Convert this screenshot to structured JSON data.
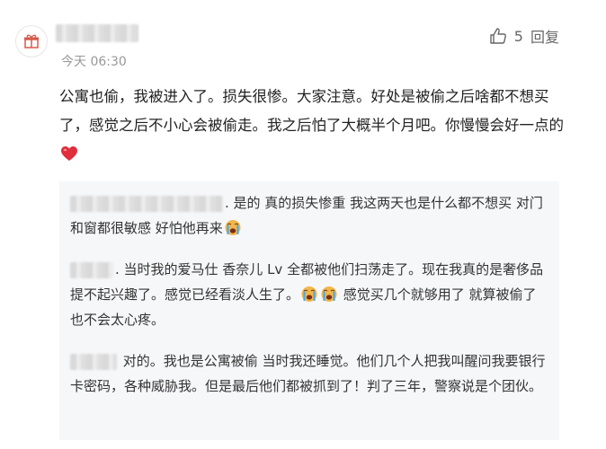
{
  "comment": {
    "time": "今天 06:30",
    "like_count": "5",
    "reply_label": "回复",
    "text": "公寓也偷，我被进入了。损失很惨。大家注意。好处是被偷之后啥都不想买了，感觉之后不小心会被偷走。我之后怕了大概半个月吧。你慢慢会好一点的"
  },
  "replies": [
    {
      "text_a": ". 是的 真的损失惨重 我这两天也是什么都不想买 对门和窗都很敏感 好怕他再来",
      "text_b": ""
    },
    {
      "text_a": ". 当时我的爱马仕 香奈儿 Lv 全都被他们扫荡走了。现在我真的是奢侈品提不起兴趣了。感觉已经看淡人生了。",
      "text_b": " 感觉买几个就够用了 就算被偷了也不会太心疼。"
    },
    {
      "text_a": " 对的。我也是公寓被偷 当时我还睡觉。他们几个人把我叫醒问我要银行卡密码，各种威胁我。但是最后他们都被抓到了！判了三年，警察说是个团伙。",
      "text_b": ""
    }
  ],
  "icons": {
    "avatar": "gift-icon",
    "like": "thumbs-up-icon",
    "heart": "red-heart-emoji",
    "crying": "loudly-crying-face-emoji"
  },
  "colors": {
    "heart": "#e02e3c",
    "emoji_face": "#f3b64a",
    "reply_bg": "#f6f7f9",
    "meta_text": "#999999"
  }
}
